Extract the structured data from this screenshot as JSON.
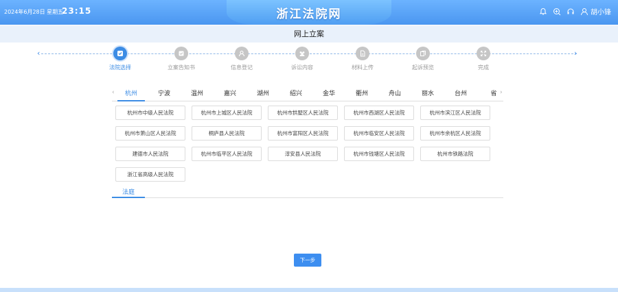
{
  "header": {
    "date": "2024年6月28日 星期五",
    "time": "23:15",
    "title": "浙江法院网",
    "user_name": "胡小锋",
    "icons": [
      "bell-icon",
      "zoom-in-icon",
      "headset-icon",
      "user-icon"
    ]
  },
  "page_title": "网上立案",
  "steps": [
    {
      "label": "法院选择",
      "icon": "check-icon",
      "active": true
    },
    {
      "label": "立案告知书",
      "icon": "notice-icon",
      "active": false
    },
    {
      "label": "信息登记",
      "icon": "person-icon",
      "active": false
    },
    {
      "label": "诉讼内容",
      "icon": "group-icon",
      "active": false
    },
    {
      "label": "材料上传",
      "icon": "document-icon",
      "active": false
    },
    {
      "label": "起诉预览",
      "icon": "copy-icon",
      "active": false
    },
    {
      "label": "完成",
      "icon": "expand-icon",
      "active": false
    }
  ],
  "cities": [
    "杭州",
    "宁波",
    "温州",
    "嘉兴",
    "湖州",
    "绍兴",
    "金华",
    "衢州",
    "舟山",
    "丽水",
    "台州",
    "省"
  ],
  "selected_city": "杭州",
  "courts": [
    "杭州市中级人民法院",
    "杭州市上城区人民法院",
    "杭州市拱墅区人民法院",
    "杭州市西湖区人民法院",
    "杭州市滨江区人民法院",
    "杭州市萧山区人民法院",
    "桐庐县人民法院",
    "杭州市富阳区人民法院",
    "杭州市临安区人民法院",
    "杭州市余杭区人民法院",
    "建德市人民法院",
    "杭州市临平区人民法院",
    "淳安县人民法院",
    "杭州市钱塘区人民法院",
    "杭州市铁路法院",
    "浙江省高级人民法院"
  ],
  "tribunal_tab": "法庭",
  "next_button": "下一步",
  "colors": {
    "accent": "#3c8ce4",
    "header": "#4a96f0"
  }
}
